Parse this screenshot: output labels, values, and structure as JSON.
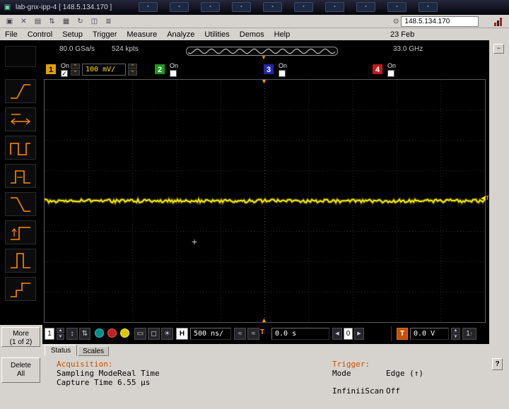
{
  "titlebar": {
    "title": "lab-gnx-ipp-4 [ 148.5.134.170 ]"
  },
  "address_bar": {
    "ip": "148.5.134.170"
  },
  "menu": {
    "items": [
      "File",
      "Control",
      "Setup",
      "Trigger",
      "Measure",
      "Analyze",
      "Utilities",
      "Demos",
      "Help"
    ],
    "date": "23 Feb"
  },
  "acquisition_bar": {
    "sample_rate": "80.0 GSa/s",
    "memory_depth": "524 kpts",
    "bandwidth": "33.0 GHz"
  },
  "channels": [
    {
      "number": "1",
      "state": "On",
      "scale": "100 mV/",
      "color": "#e0a000",
      "checked": true
    },
    {
      "number": "2",
      "state": "On",
      "color": "#1a9a1a",
      "checked": false
    },
    {
      "number": "3",
      "state": "On",
      "color": "#2626a8",
      "checked": false
    },
    {
      "number": "4",
      "state": "On",
      "color": "#c41a1a",
      "checked": false
    }
  ],
  "display": {
    "trace_color": "#f0e400",
    "trigger_marker_color": "#ff9000",
    "trigger_level_label": "T"
  },
  "marker_controls": {
    "marker_number": "1"
  },
  "horizontal_controls": {
    "menu_button": "H",
    "scale": "500 ns/",
    "position": "0.0 s",
    "delay_digit": "0"
  },
  "trigger_controls": {
    "button_label": "T",
    "level": "0.0 V",
    "source": "1"
  },
  "sidebar": {
    "more_line1": "More",
    "more_line2": "(1 of 2)",
    "delete_line1": "Delete",
    "delete_line2": "All"
  },
  "tabs": {
    "status": "Status",
    "scales": "Scales"
  },
  "status_panel": {
    "acquisition_heading": "Acquisition:",
    "sampling_mode_label": "Sampling Mode",
    "sampling_mode_value": "Real Time",
    "capture_time_label": "Capture Time",
    "capture_time_value": "6.55 µs",
    "trigger_heading": "Trigger:",
    "mode_label": "Mode",
    "mode_value": "Edge (↑)",
    "infiniiscan_label": "InfiniiScan",
    "infiniiscan_value": "Off",
    "help_button": "?"
  },
  "icons": {
    "app": "▣",
    "toolbar_dot": "▪",
    "monitor": "▣",
    "close": "✕",
    "grid": "▤",
    "swap": "⇅",
    "panel": "▦",
    "refresh": "↻",
    "window": "◫",
    "list": "≣",
    "target": "⊙",
    "check": "✓",
    "wave": "≈",
    "sun": "☀",
    "up": "▲",
    "down": "▼",
    "left": "◀",
    "right": "▶",
    "updown": "↕",
    "swap2": "⇅",
    "crosshair": "+",
    "trig_down": "▼",
    "trig_up": "▲",
    "minus": "−",
    "screen": "▭",
    "screen2": "◻",
    "arrow_up_small": "↑"
  }
}
